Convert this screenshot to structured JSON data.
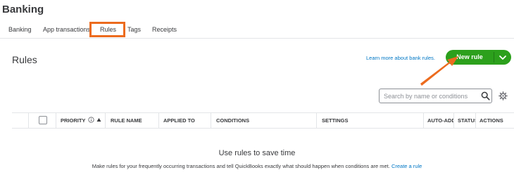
{
  "header": {
    "title": "Banking"
  },
  "tabs": [
    {
      "label": "Banking",
      "active": false
    },
    {
      "label": "App transactions",
      "active": false
    },
    {
      "label": "Rules",
      "active": true
    },
    {
      "label": "Tags",
      "active": false
    },
    {
      "label": "Receipts",
      "active": false
    }
  ],
  "rules": {
    "title": "Rules",
    "learn_link": "Learn more about bank rules.",
    "new_rule_label": "New rule",
    "search": {
      "placeholder": "Search by name or conditions",
      "value": ""
    },
    "columns": {
      "priority": "PRIORITY",
      "rule_name": "RULE NAME",
      "applied_to": "APPLIED TO",
      "conditions": "CONDITIONS",
      "settings": "SETTINGS",
      "auto_add": "AUTO-ADD",
      "status": "STATUS",
      "actions": "ACTIONS"
    },
    "empty": {
      "title": "Use rules to save time",
      "description": "Make rules for your frequently occurring transactions and tell QuickBooks exactly what should happen when conditions are met.",
      "link": "Create a rule"
    }
  },
  "colors": {
    "brand_green": "#2ca01c",
    "link_blue": "#0077c5",
    "annotation_orange": "#ec6b1e",
    "text": "#393a3d"
  },
  "icons": [
    "info-icon",
    "sort-up-icon",
    "chevron-down-icon",
    "search-icon",
    "gear-icon",
    "annotation-arrow"
  ]
}
